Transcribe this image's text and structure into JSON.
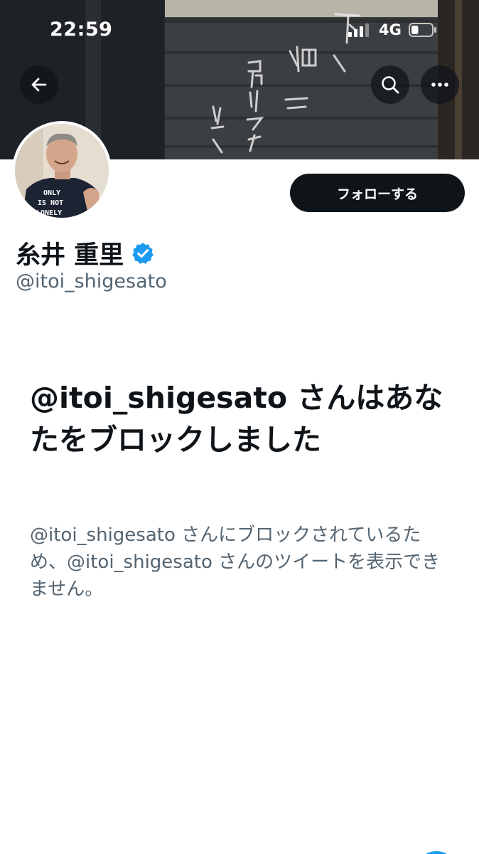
{
  "status_bar": {
    "time": "22:59",
    "network": "4G",
    "signal_icon": "cellular-signal-icon",
    "battery_icon": "battery-icon",
    "battery_level": 0.35
  },
  "header": {
    "back_icon": "arrow-left-icon",
    "search_icon": "search-icon",
    "more_icon": "more-horizontal-icon"
  },
  "profile": {
    "display_name": "糸井 重里",
    "handle": "@itoi_shigesato",
    "verified_icon": "verified-badge-icon",
    "follow_label": "フォローする",
    "avatar_shirt_line1": "ONLY",
    "avatar_shirt_line2": "IS NOT",
    "avatar_shirt_line3": "LONELY"
  },
  "blocked": {
    "title": "@itoi_shigesato さんはあなたをブロックしました",
    "description": "@itoi_shigesato さんにブロックされているため、@itoi_shigesato さんのツイートを表示できません。"
  },
  "colors": {
    "text_primary": "#0f1419",
    "text_secondary": "#536471",
    "accent": "#1d9bf0",
    "button_dark": "#0f1419"
  }
}
